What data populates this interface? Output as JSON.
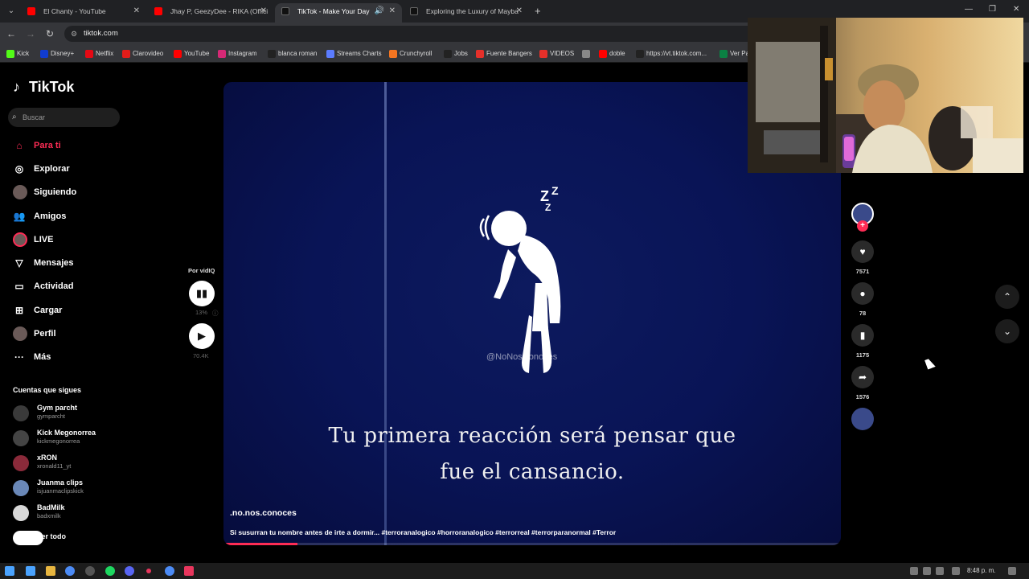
{
  "browser": {
    "tabs": [
      {
        "title": "El Chanty - YouTube",
        "favicon_color": "#ff0000"
      },
      {
        "title": "Jhay P, GeezyDee - RIKA (Offici",
        "favicon_color": "#ff0000"
      },
      {
        "title": "TikTok - Make Your Day",
        "favicon_color": "#111111"
      },
      {
        "title": "Exploring the Luxury of Mayba",
        "favicon_color": "#111111"
      }
    ],
    "url": "tiktok.com",
    "bookmarks": [
      {
        "label": "Kick",
        "color": "#53fc18"
      },
      {
        "label": "Disney+",
        "color": "#113ccf"
      },
      {
        "label": "Netflix",
        "color": "#e50914"
      },
      {
        "label": "Clarovideo",
        "color": "#e31d1a"
      },
      {
        "label": "YouTube",
        "color": "#ff0000"
      },
      {
        "label": "Instagram",
        "color": "#d62976"
      },
      {
        "label": "blanca roman",
        "color": "#222222"
      },
      {
        "label": "Streams Charts",
        "color": "#5b7cff"
      },
      {
        "label": "Crunchyroll",
        "color": "#f47521"
      },
      {
        "label": "Jobs",
        "color": "#222222"
      },
      {
        "label": "Fuente Bangers",
        "color": "#e5302a"
      },
      {
        "label": "VIDEOS",
        "color": "#e5302a"
      },
      {
        "label": "",
        "color": "#888888"
      },
      {
        "label": "doble",
        "color": "#ff0000"
      },
      {
        "label": "https://vt.tiktok.com...",
        "color": "#222222"
      },
      {
        "label": "Ver Pa",
        "color": "#0b8043"
      }
    ]
  },
  "sidebar": {
    "logo": "TikTok",
    "search_placeholder": "Buscar",
    "nav": [
      {
        "label": "Para ti",
        "icon": "home-icon",
        "glyph": "⌂"
      },
      {
        "label": "Explorar",
        "icon": "compass-icon",
        "glyph": "◎"
      },
      {
        "label": "Siguiendo",
        "icon": "following-avatar-icon",
        "glyph": ""
      },
      {
        "label": "Amigos",
        "icon": "friends-icon",
        "glyph": "👥"
      },
      {
        "label": "LIVE",
        "icon": "live-avatar-icon",
        "glyph": ""
      },
      {
        "label": "Mensajes",
        "icon": "messages-icon",
        "glyph": "▽"
      },
      {
        "label": "Actividad",
        "icon": "activity-icon",
        "glyph": "▭"
      },
      {
        "label": "Cargar",
        "icon": "upload-icon",
        "glyph": "⊞"
      },
      {
        "label": "Perfil",
        "icon": "profile-avatar-icon",
        "glyph": ""
      },
      {
        "label": "Más",
        "icon": "more-icon",
        "glyph": "···"
      }
    ],
    "following_title": "Cuentas que sigues",
    "following": [
      {
        "name": "Gym parcht",
        "handle": "gymparcht",
        "color": "#3a3a3a"
      },
      {
        "name": "Kick Megonorrea",
        "handle": "kickmegonorrea",
        "color": "#444444"
      },
      {
        "name": "xRON",
        "handle": "xronald11_yt",
        "color": "#8a2a3a"
      },
      {
        "name": "Juanma clips",
        "handle": "isjuanmaclipskick",
        "color": "#6a88b8"
      },
      {
        "name": "BadMilk",
        "handle": "badxmilk",
        "color": "#d8d8d8"
      }
    ],
    "see_all": "Ver todo"
  },
  "video": {
    "watermark": "@NoNosConoces",
    "subtitle_line1": "Tu primera reacción será pensar que",
    "subtitle_line2": "fue el cansancio.",
    "author": ".no.nos.conoces",
    "description": "Si susurran tu nombre antes de irte a dormir... #terroranalogico #horroranalogico #terrorreal #terrorparanormal #Terror",
    "progress": 0.12
  },
  "vidiq": {
    "label": "Por vidIQ",
    "score": "13%",
    "views": "70.4K"
  },
  "actions": {
    "likes": "7571",
    "comments": "78",
    "saves": "1175",
    "shares": "1576"
  },
  "taskbar": {
    "clock": "8:48 p. m."
  },
  "colors": {
    "accent": "#fe2c55",
    "video_bg": "#091456"
  }
}
